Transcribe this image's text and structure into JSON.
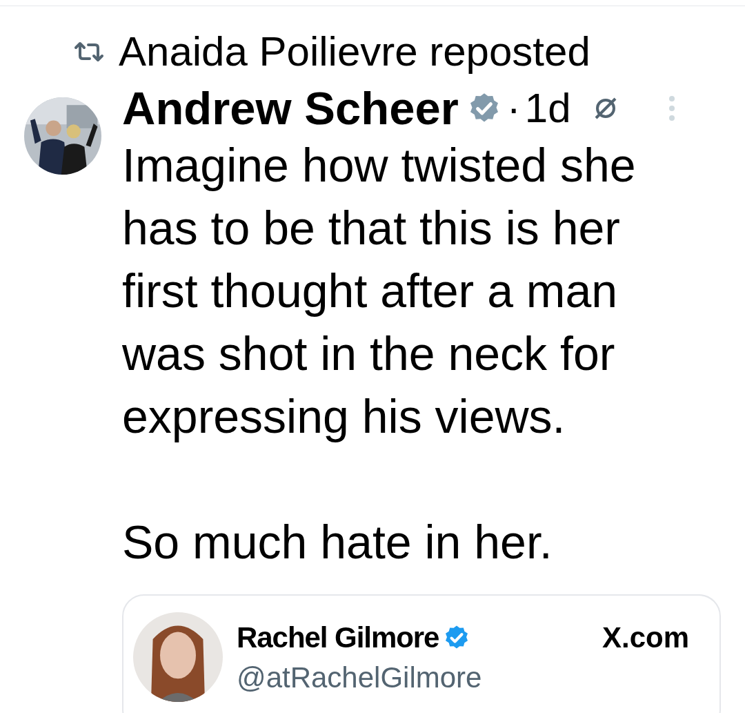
{
  "repost": {
    "text": "Anaida Poilievre reposted"
  },
  "tweet": {
    "author": "Andrew Scheer",
    "verified": true,
    "color": "#829aab",
    "separator": "·",
    "time": "1d",
    "paragraphs": [
      "Imagine how twisted she has to be that this is her first thought after a man was shot in the neck for expressing his views.",
      "So much hate in her."
    ]
  },
  "quote": {
    "name": "Rachel Gilmore",
    "verified": true,
    "color": "#1d9bf0",
    "handle": "@atRachelGilmore",
    "site": "X.com"
  }
}
